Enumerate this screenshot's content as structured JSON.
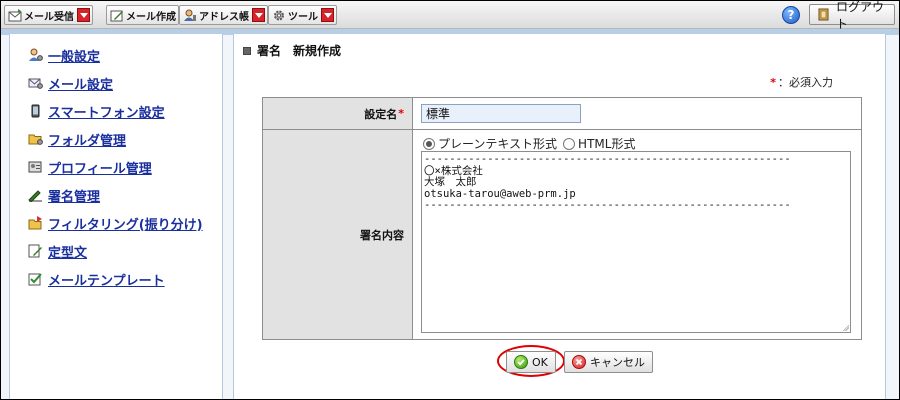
{
  "toolbar": {
    "mail_receive": "メール受信",
    "mail_compose": "メール作成",
    "address_book": "アドレス帳",
    "tools": "ツール",
    "help": "?",
    "logout": "ログアウト"
  },
  "sidebar": {
    "items": [
      {
        "label": "一般設定",
        "icon": "user-settings-icon"
      },
      {
        "label": "メール設定",
        "icon": "mail-settings-icon"
      },
      {
        "label": "スマートフォン設定",
        "icon": "smartphone-icon"
      },
      {
        "label": "フォルダ管理",
        "icon": "folder-icon"
      },
      {
        "label": "プロフィール管理",
        "icon": "profile-card-icon"
      },
      {
        "label": "署名管理",
        "icon": "pen-icon"
      },
      {
        "label": "フィルタリング(振り分け)",
        "icon": "filter-folder-icon"
      },
      {
        "label": "定型文",
        "icon": "document-pencil-icon"
      },
      {
        "label": "メールテンプレート",
        "icon": "template-check-icon"
      }
    ]
  },
  "main": {
    "title": "署名　新規作成",
    "required_star": "*",
    "required_text": "：必須入力",
    "form": {
      "name_label": "設定名",
      "name_star": "*",
      "name_value": "標準",
      "content_label": "署名内容",
      "format_options": [
        {
          "label": "プレーンテキスト形式",
          "selected": true
        },
        {
          "label": "HTML形式",
          "selected": false
        }
      ],
      "signature_text": "----------------------------------------------------------\n〇×株式会社\n大塚　太郎\notsuka-tarou@aweb-prm.jp\n----------------------------------------------------------"
    },
    "ok_label": "OK",
    "cancel_label": "キャンセル"
  },
  "colors": {
    "link": "#1a2f9e",
    "required": "#e00000",
    "dropdown_red": "#d8232a",
    "panel_border": "#b5c9dc",
    "band_blue": "#b7cfe6"
  }
}
